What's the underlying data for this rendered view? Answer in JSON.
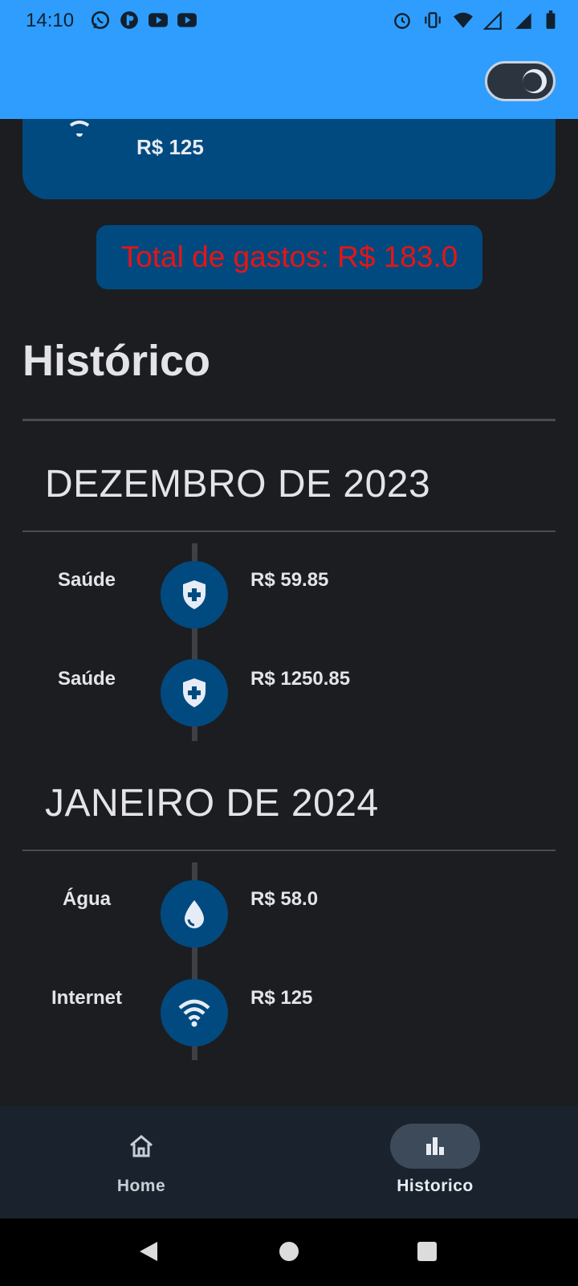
{
  "status_bar": {
    "time": "14:10"
  },
  "app_bar": {
    "theme_toggle": "dark-mode-toggle"
  },
  "top_card": {
    "amount": "R$ 125",
    "icon": "wifi-icon"
  },
  "total": {
    "text": "Total de gastos: R$ 183.0"
  },
  "history": {
    "title": "Histórico",
    "months": [
      {
        "label": "DEZEMBRO DE 2023",
        "entries": [
          {
            "category": "Saúde",
            "amount": "R$ 59.85",
            "icon": "health-shield-icon"
          },
          {
            "category": "Saúde",
            "amount": "R$ 1250.85",
            "icon": "health-shield-icon"
          }
        ]
      },
      {
        "label": "JANEIRO DE 2024",
        "entries": [
          {
            "category": "Água",
            "amount": "R$ 58.0",
            "icon": "water-drop-icon"
          },
          {
            "category": "Internet",
            "amount": "R$ 125",
            "icon": "wifi-icon"
          }
        ]
      }
    ]
  },
  "bottom_nav": {
    "items": [
      {
        "label": "Home",
        "icon": "home-icon",
        "active": false
      },
      {
        "label": "Historico",
        "icon": "bar-chart-icon",
        "active": true
      }
    ]
  },
  "colors": {
    "accent": "#2e9dfd",
    "card": "#014a80",
    "total_text": "#e81414",
    "background": "#1c1d20"
  }
}
